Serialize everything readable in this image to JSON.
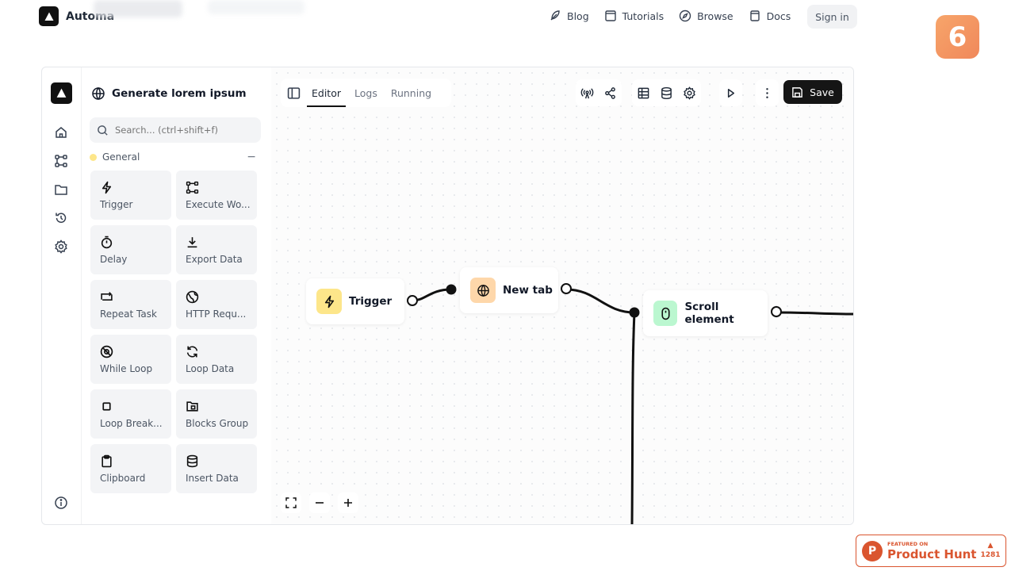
{
  "site": {
    "brand": "Automa"
  },
  "nav": {
    "links": [
      {
        "label": "Blog",
        "icon": "feather-icon"
      },
      {
        "label": "Tutorials",
        "icon": "book-icon"
      },
      {
        "label": "Browse",
        "icon": "compass-icon"
      },
      {
        "label": "Docs",
        "icon": "document-icon"
      }
    ],
    "signin": "Sign in"
  },
  "badge": "6",
  "editor": {
    "workflow_title": "Generate lorem ipsum",
    "search_placeholder": "Search... (ctrl+shift+f)",
    "category": "General",
    "category_toggle": "−",
    "blocks": [
      {
        "label": "Trigger",
        "icon": "lightning-icon"
      },
      {
        "label": "Execute Wo...",
        "icon": "workflow-icon"
      },
      {
        "label": "Delay",
        "icon": "timer-icon"
      },
      {
        "label": "Export Data",
        "icon": "download-icon"
      },
      {
        "label": "Repeat Task",
        "icon": "repeat-icon"
      },
      {
        "label": "HTTP Requ...",
        "icon": "globe-icon"
      },
      {
        "label": "While Loop",
        "icon": "loop-icon"
      },
      {
        "label": "Loop Data",
        "icon": "refresh-icon"
      },
      {
        "label": "Loop Break...",
        "icon": "stop-icon"
      },
      {
        "label": "Blocks Group",
        "icon": "folder-group-icon"
      },
      {
        "label": "Clipboard",
        "icon": "clipboard-icon"
      },
      {
        "label": "Insert Data",
        "icon": "database-icon"
      }
    ],
    "tabs": [
      "Editor",
      "Logs",
      "Running"
    ],
    "active_tab": "Editor",
    "save_label": "Save",
    "nodes": [
      {
        "label": "Trigger",
        "icon": "lightning-icon",
        "color": "#fde68a"
      },
      {
        "label": "New tab",
        "icon": "globe-icon",
        "color": "#fed7aa"
      },
      {
        "label": "Scroll element",
        "icon": "mouse-icon",
        "color": "#bbf7d0"
      }
    ]
  },
  "product_hunt": {
    "featured": "FEATURED ON",
    "name": "Product Hunt",
    "votes": "1281"
  }
}
